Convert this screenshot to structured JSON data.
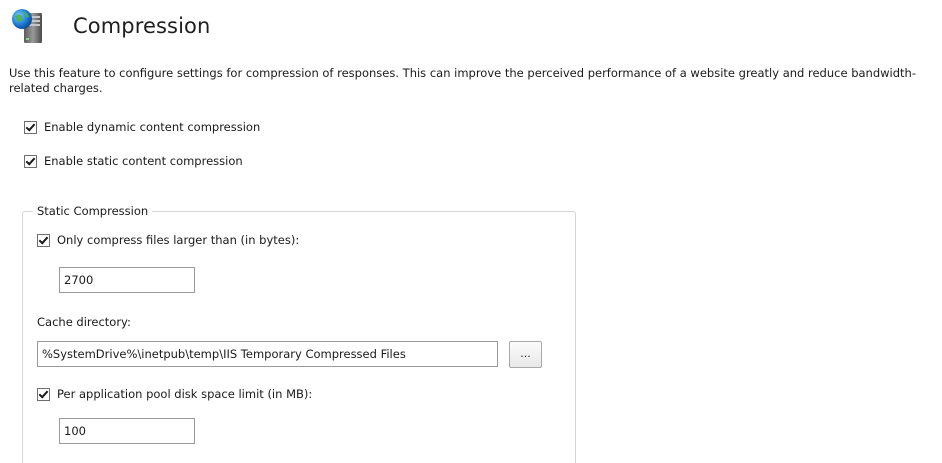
{
  "header": {
    "title": "Compression",
    "icon": "iis-server-globe-icon"
  },
  "description": "Use this feature to configure settings for compression of responses. This can improve the perceived performance of a website greatly and reduce bandwidth-related charges.",
  "options": {
    "dynamic": {
      "label": "Enable dynamic content compression",
      "checked": true
    },
    "static": {
      "label": "Enable static content compression",
      "checked": true
    }
  },
  "static_compression": {
    "group_title": "Static Compression",
    "only_compress_larger": {
      "label": "Only compress files larger than (in bytes):",
      "checked": true,
      "value": "2700"
    },
    "cache_directory": {
      "label": "Cache directory:",
      "value": "%SystemDrive%\\inetpub\\temp\\IIS Temporary Compressed Files",
      "browse_label": "..."
    },
    "disk_space_limit": {
      "label": "Per application pool disk space limit (in MB):",
      "checked": true,
      "value": "100"
    }
  }
}
